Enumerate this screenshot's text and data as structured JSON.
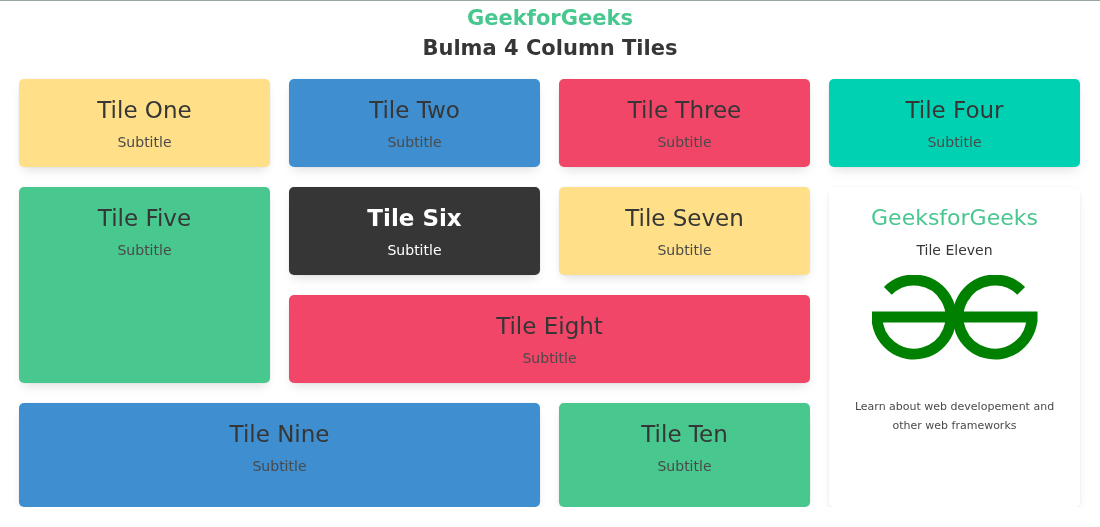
{
  "header": {
    "brand": "GeekforGeeks",
    "heading": "Bulma 4 Column Tiles"
  },
  "tiles": [
    {
      "kind": "colored",
      "title": "Tile One",
      "subtitle": "Subtitle",
      "color": "#ffdf88"
    },
    {
      "kind": "colored",
      "title": "Tile Two",
      "subtitle": "Subtitle",
      "color": "#3e8ed0"
    },
    {
      "kind": "colored",
      "title": "Tile Three",
      "subtitle": "Subtitle",
      "color": "#f14668"
    },
    {
      "kind": "colored",
      "title": "Tile Four",
      "subtitle": "Subtitle",
      "color": "#00d1b2"
    },
    {
      "kind": "colored",
      "title": "Tile Five",
      "subtitle": "Subtitle",
      "color": "#48c78e"
    },
    {
      "kind": "colored",
      "title": "Tile Six",
      "subtitle": "Subtitle",
      "color": "#363636"
    },
    {
      "kind": "colored",
      "title": "Tile Seven",
      "subtitle": "Subtitle",
      "color": "#ffdf88"
    },
    {
      "kind": "colored",
      "title": "Tile Eight",
      "subtitle": "Subtitle",
      "color": "#f14668"
    },
    {
      "kind": "colored",
      "title": "Tile Nine",
      "subtitle": "Subtitle",
      "color": "#3e8ed0"
    },
    {
      "kind": "colored",
      "title": "Tile Ten",
      "subtitle": "Subtitle",
      "color": "#48c78e"
    },
    {
      "kind": "card",
      "title": "GeeksforGeeks",
      "subtitle": "Tile Eleven",
      "description": "Learn about web developement and other web frameworks"
    }
  ]
}
